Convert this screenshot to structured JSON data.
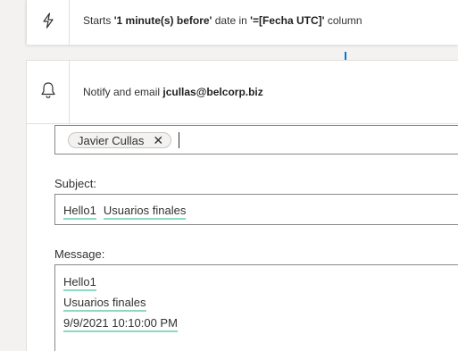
{
  "trigger": {
    "prefix": "Starts ",
    "offset": "'1 minute(s) before'",
    "middle": " date in ",
    "column": "'=[Fecha UTC]'",
    "suffix": " column",
    "icon": "lightning-icon"
  },
  "action": {
    "prefix": "Notify and email ",
    "email": "jcullas@belcorp.biz",
    "icon": "bell-icon"
  },
  "to": {
    "recipients": [
      {
        "name": "Javier Cullas",
        "remove_glyph": "✕"
      }
    ]
  },
  "subject": {
    "label": "Subject:",
    "tokens": [
      "Hello1",
      "Usuarios finales"
    ]
  },
  "message": {
    "label": "Message:",
    "tokens": [
      "Hello1",
      "Usuarios finales",
      "9/9/2021 10:10:00 PM"
    ]
  },
  "colors": {
    "token_underline": "#8cd9c3",
    "connector": "#0078d4"
  }
}
